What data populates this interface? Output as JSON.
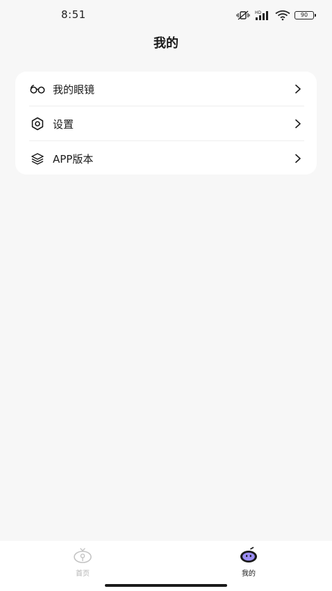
{
  "status_bar": {
    "time": "8:51",
    "battery": "90",
    "icons": [
      "vibrate-off-icon",
      "hd-signal-icon",
      "wifi-icon",
      "battery-icon"
    ]
  },
  "header": {
    "title": "我的"
  },
  "menu": {
    "items": [
      {
        "label": "我的眼镜",
        "icon": "glasses-icon"
      },
      {
        "label": "设置",
        "icon": "settings-icon"
      },
      {
        "label": "APP版本",
        "icon": "layers-icon"
      }
    ]
  },
  "tab_bar": {
    "tabs": [
      {
        "label": "首页",
        "icon": "home-tab-icon",
        "active": false
      },
      {
        "label": "我的",
        "icon": "mine-tab-icon",
        "active": true
      }
    ]
  },
  "colors": {
    "background": "#f7f7f7",
    "card": "#ffffff",
    "text": "#1a1a1a",
    "inactive": "#b5b5b5",
    "accent": "#9b8df5"
  }
}
